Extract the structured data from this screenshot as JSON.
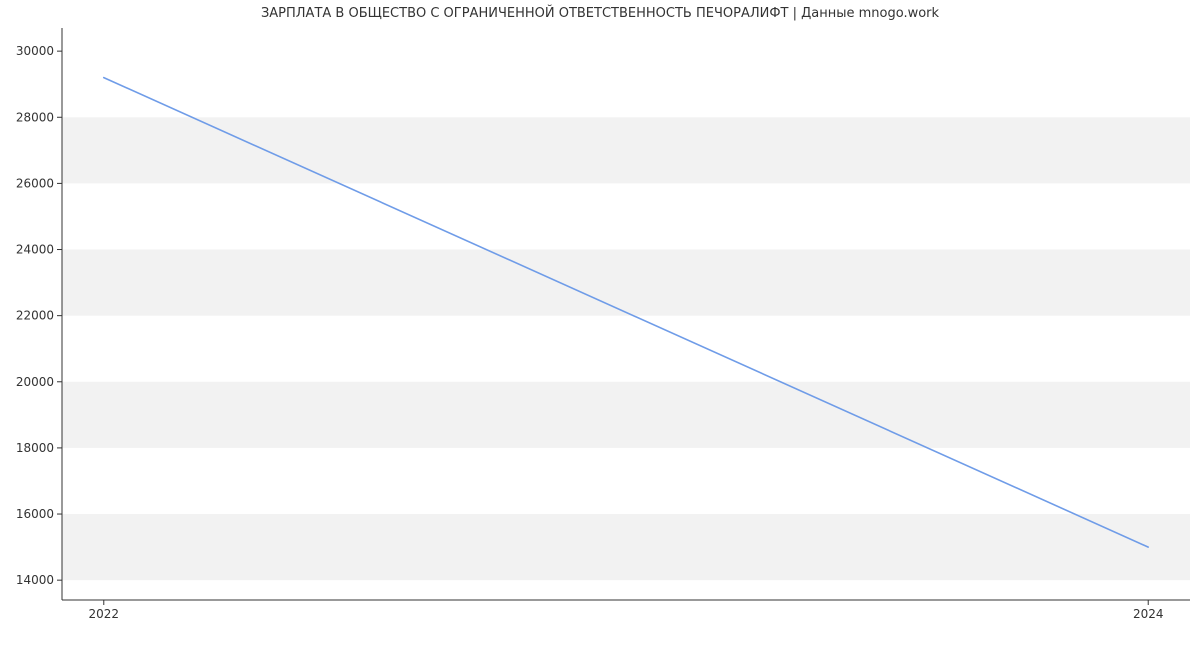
{
  "chart_data": {
    "type": "line",
    "title": "ЗАРПЛАТА В ОБЩЕСТВО С ОГРАНИЧЕННОЙ ОТВЕТСТВЕННОСТЬ ПЕЧОРАЛИФТ | Данные mnogo.work",
    "x": [
      2022,
      2024
    ],
    "values": [
      29200,
      15000
    ],
    "xlabel": "",
    "ylabel": "",
    "x_ticks": [
      2022,
      2024
    ],
    "y_ticks": [
      14000,
      16000,
      18000,
      20000,
      22000,
      24000,
      26000,
      28000,
      30000
    ],
    "xlim": [
      2021.92,
      2024.08
    ],
    "ylim": [
      13400,
      30700
    ],
    "line_color": "#6f9ce8",
    "grid_band_color": "#f2f2f2",
    "axis_color": "#333333"
  }
}
